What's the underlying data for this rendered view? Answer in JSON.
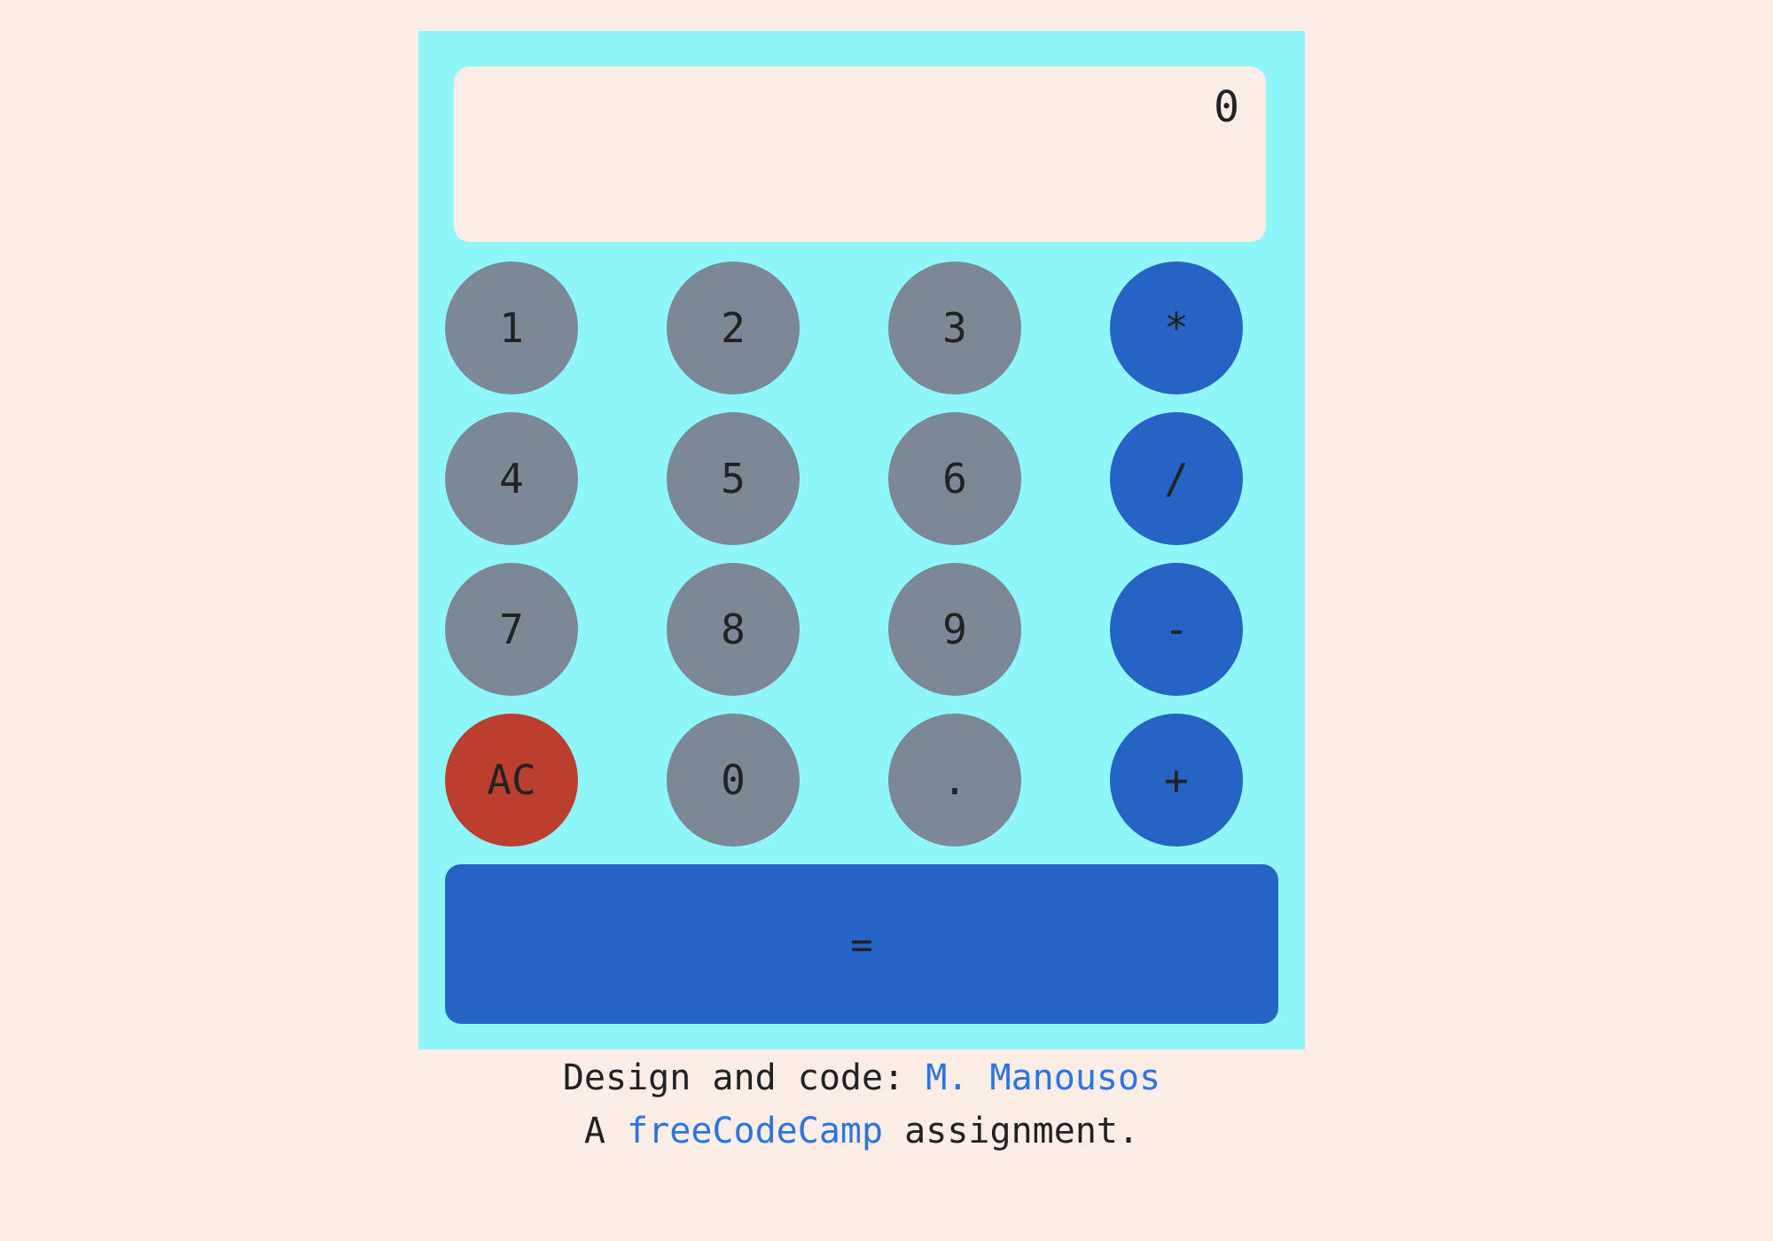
{
  "display": {
    "value": "0"
  },
  "keys": {
    "k1": "1",
    "k2": "2",
    "k3": "3",
    "multiply": "*",
    "k4": "4",
    "k5": "5",
    "k6": "6",
    "divide": "/",
    "k7": "7",
    "k8": "8",
    "k9": "9",
    "subtract": "-",
    "clear": "AC",
    "k0": "0",
    "decimal": ".",
    "add": "+",
    "equals": "="
  },
  "footer": {
    "credit_prefix": "Design and code:",
    "author_link": "M. Manousos",
    "assignment_prefix": "A",
    "fcc_link": "freeCodeCamp",
    "assignment_suffix": "assignment."
  },
  "colors": {
    "page_background": "#fcede6",
    "calculator_background": "#8ff7f9",
    "number_key": "#7c8895",
    "operator_key": "#2563c4",
    "clear_key": "#bb3e2e",
    "link": "#2e74e0"
  }
}
